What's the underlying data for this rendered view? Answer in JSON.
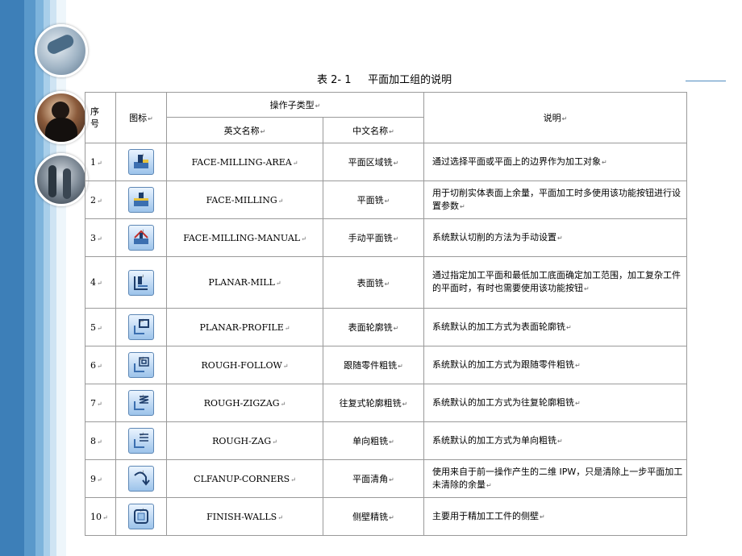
{
  "caption": "表 2- 1     平面加工组的说明",
  "table": {
    "headers": {
      "seq": "序号",
      "icon": "图标",
      "type_group": "操作子类型",
      "en": "英文名称",
      "cn": "中文名称",
      "desc": "说明"
    },
    "rows": [
      {
        "seq": "1",
        "icon": "face-milling-area-icon",
        "en": "FACE-MILLING-AREA",
        "cn": "平面区域铣",
        "desc": "通过选择平面或平面上的边界作为加工对象"
      },
      {
        "seq": "2",
        "icon": "face-milling-icon",
        "en": "FACE-MILLING",
        "cn": "平面铣",
        "desc": "用于切削实体表面上余量，平面加工时多使用该功能按钮进行设置参数"
      },
      {
        "seq": "3",
        "icon": "face-milling-manual-icon",
        "en": "FACE-MILLING-MANUAL",
        "cn": "手动平面铣",
        "desc": "系统默认切削的方法为手动设置"
      },
      {
        "seq": "4",
        "icon": "planar-mill-icon",
        "en": "PLANAR-MILL",
        "cn": "表面铣",
        "desc": "通过指定加工平面和最低加工底面确定加工范围，加工复杂工件的平面时，有时也需要使用该功能按钮"
      },
      {
        "seq": "5",
        "icon": "planar-profile-icon",
        "en": "PLANAR-PROFILE",
        "cn": "表面轮廓铣",
        "desc": "系统默认的加工方式为表面轮廓铣"
      },
      {
        "seq": "6",
        "icon": "rough-follow-icon",
        "en": "ROUGH-FOLLOW",
        "cn": "跟随零件粗铣",
        "desc": "系统默认的加工方式为跟随零件粗铣"
      },
      {
        "seq": "7",
        "icon": "rough-zigzag-icon",
        "en": "ROUGH-ZIGZAG",
        "cn": "往复式轮廓粗铣",
        "desc": "系统默认的加工方式为往复轮廓粗铣"
      },
      {
        "seq": "8",
        "icon": "rough-zag-icon",
        "en": "ROUGH-ZAG",
        "cn": "单向粗铣",
        "desc": "系统默认的加工方式为单向粗铣"
      },
      {
        "seq": "9",
        "icon": "clfanup-corners-icon",
        "en": "CLFANUP-CORNERS",
        "cn": "平面清角",
        "desc": "使用来自于前一操作产生的二维 IPW，只是清除上一步平面加工未清除的余量"
      },
      {
        "seq": "10",
        "icon": "finish-walls-icon",
        "en": "FINISH-WALLS",
        "cn": "侧壁精铣",
        "desc": "主要用于精加工工件的侧壁"
      }
    ]
  },
  "colors": {
    "stripe_dark": "#3d7fb8",
    "accent_line": "#4f8cc0"
  }
}
